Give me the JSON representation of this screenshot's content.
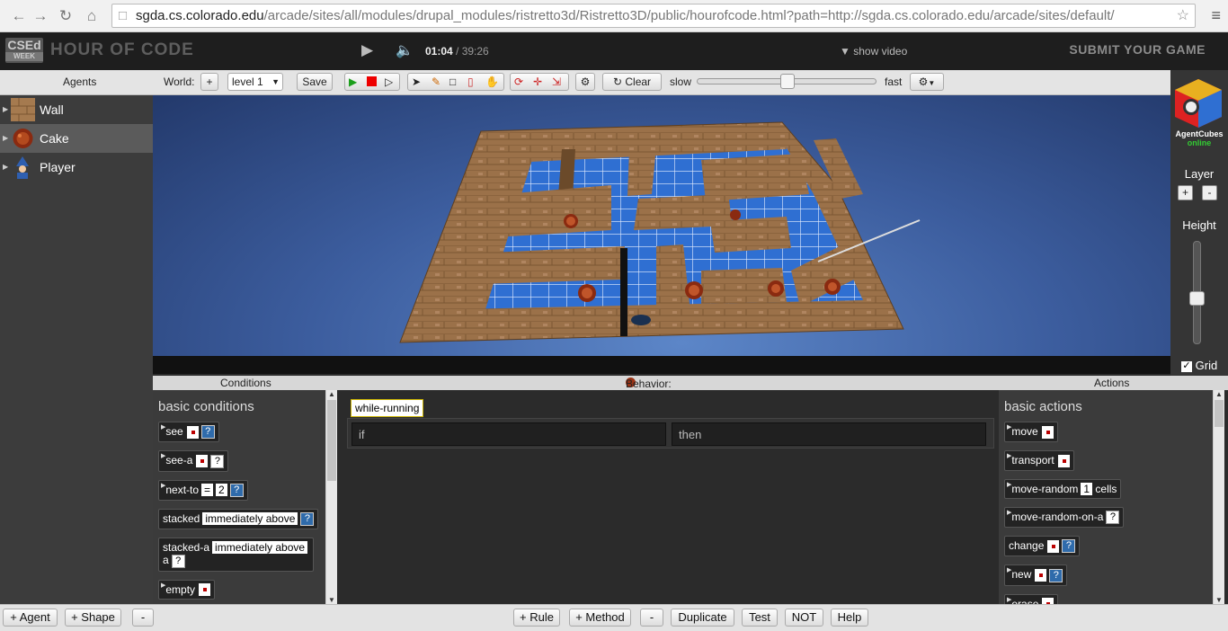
{
  "browser": {
    "url_domain": "sgda.cs.colorado.edu",
    "url_path": "/arcade/sites/all/modules/drupal_modules/ristretto3d/Ristretto3D/public/hourofcode.html?path=http://sgda.cs.colorado.edu/arcade/sites/default/"
  },
  "header": {
    "logo_text": "CSEd",
    "logo_sub": "WEEK",
    "title": "HOUR OF CODE",
    "time_current": "01:04",
    "time_total": " / 39:26",
    "show_video": "show video",
    "submit": "SUBMIT YOUR GAME"
  },
  "toolbar": {
    "agents_label": "Agents",
    "world_label": "World:",
    "add": "+",
    "level": "level 1",
    "save": "Save",
    "clear": "Clear",
    "slow": "slow",
    "fast": "fast",
    "speed_fraction": 0.5
  },
  "agents": [
    {
      "name": "Wall"
    },
    {
      "name": "Cake"
    },
    {
      "name": "Player"
    }
  ],
  "right_panel": {
    "brand": "AgentCubes",
    "brand_sub": "online",
    "layer": "Layer",
    "layer_plus": "+",
    "layer_minus": "-",
    "height": "Height",
    "grid": "Grid"
  },
  "sections": {
    "conditions": "Conditions",
    "behavior": "Behavior: Cake",
    "actions": "Actions"
  },
  "conditions": {
    "title": "basic conditions",
    "see": "see",
    "see_a": "see-a",
    "next_to": "next-to",
    "eq": "=",
    "two": "2",
    "stacked": "stacked",
    "stacked_a": "stacked-a",
    "imm_above": "immediately above",
    "a": "a",
    "empty": "empty",
    "q": "?"
  },
  "behavior": {
    "method": "while-running",
    "if": "if",
    "then": "then"
  },
  "actions": {
    "title": "basic actions",
    "move": "move",
    "transport": "transport",
    "move_random": "move-random",
    "one": "1",
    "cells": "cells",
    "move_random_on_a": "move-random-on-a",
    "change": "change",
    "new": "new",
    "erase": "erase",
    "q": "?"
  },
  "bottom": {
    "agent": "+ Agent",
    "shape": "+ Shape",
    "minus": "-",
    "rule": "+ Rule",
    "method": "+ Method",
    "minus2": "-",
    "duplicate": "Duplicate",
    "test": "Test",
    "not": "NOT",
    "help": "Help"
  }
}
